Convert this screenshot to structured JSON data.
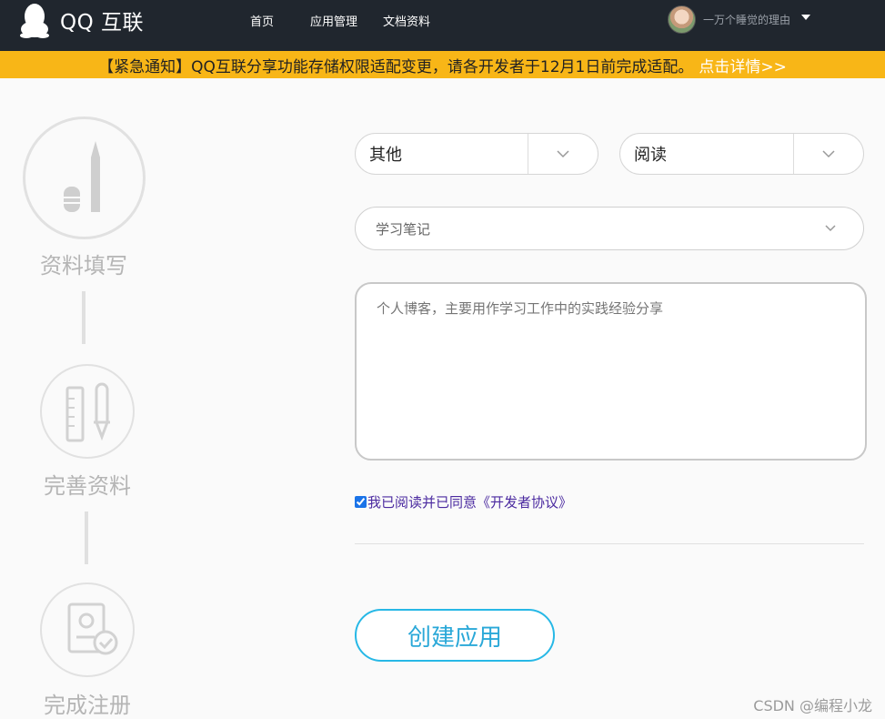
{
  "header": {
    "logo_text": "QQ 互联",
    "nav": [
      "首页",
      "应用管理",
      "文档资料"
    ],
    "user_name": "一万个睡觉的理由"
  },
  "notice": {
    "text": "【紧急通知】QQ互联分享功能存储权限适配变更，请各开发者于12月1日前完成适配。",
    "link": "点击详情>>"
  },
  "steps": [
    {
      "label": "资料填写",
      "icon": "pen-icon"
    },
    {
      "label": "完善资料",
      "icon": "ruler-pencil-icon"
    },
    {
      "label": "完成注册",
      "icon": "certificate-icon"
    }
  ],
  "form": {
    "category_primary": "其他",
    "category_secondary": "阅读",
    "app_name_value": "学习笔记",
    "description_placeholder": "个人博客，主要用作学习工作中的实践经验分享",
    "agreement_checked": true,
    "agreement_text": "我已阅读并已同意《开发者协议》",
    "submit_label": "创建应用"
  },
  "watermark": "CSDN @编程小龙",
  "colors": {
    "topbar": "#20262e",
    "notice_bg": "#f8b617",
    "accent": "#27b8e6"
  }
}
